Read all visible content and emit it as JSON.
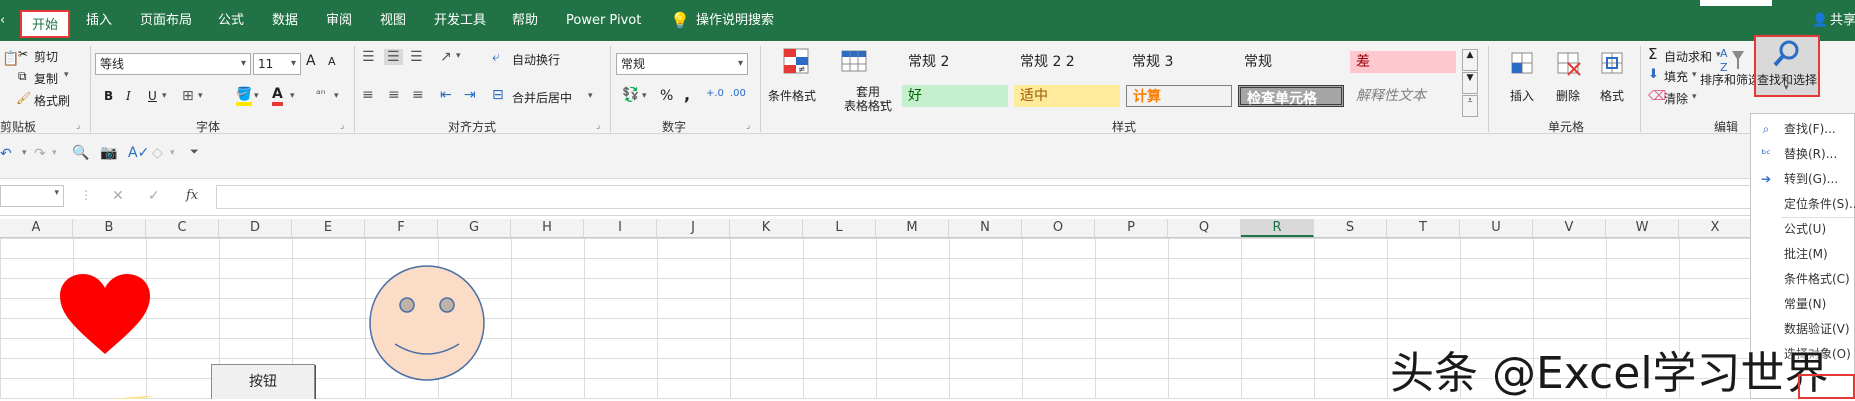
{
  "tabs": [
    {
      "id": "home",
      "label": "开始",
      "active": true
    },
    {
      "id": "insert",
      "label": "插入"
    },
    {
      "id": "layout",
      "label": "页面布局"
    },
    {
      "id": "formulas",
      "label": "公式"
    },
    {
      "id": "data",
      "label": "数据"
    },
    {
      "id": "review",
      "label": "审阅"
    },
    {
      "id": "view",
      "label": "视图"
    },
    {
      "id": "dev",
      "label": "开发工具"
    },
    {
      "id": "help",
      "label": "帮助"
    },
    {
      "id": "powerpivot",
      "label": "Power Pivot"
    }
  ],
  "tell_me": "操作说明搜索",
  "share": "共享",
  "clipboard": {
    "cut": "剪切",
    "copy": "复制",
    "format_painter": "格式刷",
    "group": "剪贴板"
  },
  "font": {
    "name": "等线",
    "size": "11",
    "group": "字体",
    "bold": "B",
    "italic": "I",
    "underline": "U",
    "grow": "A",
    "shrink": "A"
  },
  "alignment": {
    "wrap": "自动换行",
    "merge": "合并后居中",
    "group": "对齐方式"
  },
  "number": {
    "format": "常规",
    "group": "数字",
    "percent": "%",
    "comma": ","
  },
  "styles": {
    "conditional": "条件格式",
    "table_format": "套用\n表格格式",
    "cells": [
      "常规 2",
      "常规 2 2",
      "常规 3",
      "常规",
      "差",
      "好",
      "适中",
      "计算",
      "检查单元格",
      "解释性文本"
    ],
    "group": "样式"
  },
  "cells_group": {
    "insert": "插入",
    "delete": "删除",
    "format": "格式",
    "group": "单元格"
  },
  "editing": {
    "autosum": "自动求和",
    "fill": "填充",
    "clear": "清除",
    "sort": "排序和筛选",
    "find": "查找和选择",
    "group": "编辑"
  },
  "formula_bar": {
    "fx": "fx",
    "cancel": "✕",
    "enter": "✓"
  },
  "columns": [
    "A",
    "B",
    "C",
    "D",
    "E",
    "F",
    "G",
    "H",
    "I",
    "J",
    "K",
    "L",
    "M",
    "N",
    "O",
    "P",
    "Q",
    "R",
    "S",
    "T",
    "U",
    "V",
    "W",
    "X"
  ],
  "selected_column": "R",
  "button_label": "按钮",
  "dropdown": [
    {
      "label": "查找(F)...",
      "icon": "search-icon"
    },
    {
      "label": "替换(R)...",
      "icon": "replace-icon"
    },
    {
      "label": "转到(G)...",
      "icon": "arrow-right-icon"
    },
    {
      "label": "定位条件(S)...",
      "icon": ""
    },
    {
      "label": "公式(U)",
      "icon": ""
    },
    {
      "label": "批注(M)",
      "icon": ""
    },
    {
      "label": "条件格式(C)",
      "icon": ""
    },
    {
      "label": "常量(N)",
      "icon": ""
    },
    {
      "label": "数据验证(V)",
      "icon": ""
    },
    {
      "label": "选择对象(O)",
      "icon": ""
    }
  ],
  "watermark": "头条 @Excel学习世界",
  "colors": {
    "accent": "#217346",
    "highlight": "#e53935",
    "heart": "#ff0000",
    "face_fill": "#fadcc7",
    "face_stroke": "#4a6fa5"
  }
}
